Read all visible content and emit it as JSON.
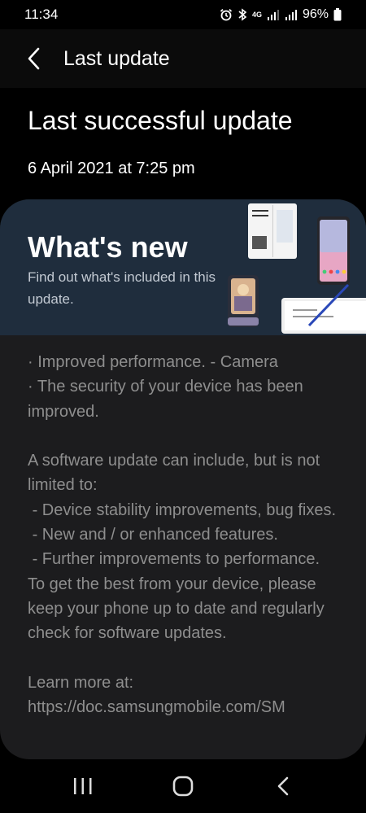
{
  "status_bar": {
    "time": "11:34",
    "network": "4G",
    "battery": "96%",
    "icons": [
      "alarm-icon",
      "bluetooth-icon",
      "signal-icon",
      "signal-icon",
      "battery-icon"
    ]
  },
  "app_bar": {
    "title": "Last update",
    "back_icon": "back-arrow-icon"
  },
  "main": {
    "heading": "Last successful update",
    "date": "6 April 2021 at 7:25 pm"
  },
  "whats_new": {
    "title": "What's new",
    "subtitle": "Find out what's included in this update.",
    "body": "· Improved performance. - Camera\n· The security of your device has been improved.\n\nA software update can include, but is not limited to:\n - Device stability improvements, bug fixes.\n - New and / or enhanced features.\n - Further improvements to performance.\nTo get the best from your device, please keep your phone up to date and regularly check for software updates.\n\nLearn more at:\nhttps://doc.samsungmobile.com/SM"
  },
  "nav_bar": {
    "icons": [
      "recent-apps-icon",
      "home-icon",
      "back-icon"
    ]
  },
  "colors": {
    "background": "#000000",
    "card": "#1c1c1e",
    "banner": "#1f2d3d",
    "body_text": "#8e8e8e"
  }
}
